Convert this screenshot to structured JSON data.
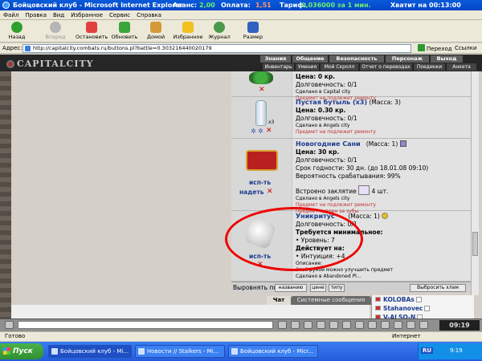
{
  "window": {
    "title": "Бойцовский клуб - Microsoft Internet Explorer",
    "advance_label": "Аванс:",
    "advance_value": "2,00",
    "payment_label": "Оплата:",
    "payment_value": "1,51",
    "tariff_label": "Тариф:",
    "tariff_value": "0,036000 за 1 мин.",
    "enough_text": "Хватит на 00:13:00"
  },
  "menu": [
    "Файл",
    "Правка",
    "Вид",
    "Избранное",
    "Сервис",
    "Справка"
  ],
  "toolbar": {
    "back": "Назад",
    "forward": "Вперед",
    "stop": "Остановить",
    "refresh": "Обновить",
    "home": "Домой",
    "favorites": "Избранное",
    "history": "Журнал",
    "size": "Размер"
  },
  "address": {
    "label": "Адрес:",
    "url": "http://capitalcity.combats.ru/buttons.pl?battle=0.303216440020179",
    "go": "Переход",
    "links": "Ссылки"
  },
  "game": {
    "logo": "CAPITALCITY",
    "nav_top": [
      "Знания",
      "Общение",
      "Безопасность",
      "Персонаж",
      "Выход"
    ],
    "nav_bottom": [
      "Инвентарь",
      "Умения",
      "Мой Скролл",
      "Отчет о переводах",
      "Поединки",
      "Анкета"
    ]
  },
  "items": [
    {
      "price": "Цена: 0 кр.",
      "durability": "Долговечность: 0/1",
      "made": "Сделано в Capital city",
      "repair": "Предмет не подлежит ремонту"
    },
    {
      "name": "Пустая бутыль (x3)",
      "mass": "(Масса: 3)",
      "price": "Цена: 0.30 кр.",
      "durability": "Долговечность: 0/1",
      "made": "Сделано в Angels city",
      "repair": "Предмет не подлежит ремонту",
      "count_badge": "x3"
    },
    {
      "name": "Новогодние Сани",
      "mass": "(Масса: 1)",
      "price": "Цена: 30 кр.",
      "durability": "Долговечность: 0/1",
      "expiry": "Срок годности: 30 дн. (до 18.01.08 09:10)",
      "chance": "Вероятность срабатывания: 99%",
      "spell": "Встроено заклятие",
      "spell_count": "4 шт.",
      "made": "Сделано в Angels city",
      "repair": "Предмет не подлежит ремонту",
      "bought": "Предмет куплен за зубы",
      "use": "исп-ть",
      "wear": "надеть"
    },
    {
      "name": "Уникритус",
      "mass": "(Масса: 1)",
      "durability": "Долговечность: 0/1",
      "req_title": "Требуется минимальное:",
      "req_level": "• Уровень: 7",
      "effect_title": "Действует на:",
      "effect_intuition": "• Интуиция: +4",
      "desc_title": "Описание:",
      "desc_text": "Этой руной можно улучшить предмет",
      "made": "Сделано в Abandoned Pl...",
      "use": "исп-ть"
    }
  ],
  "sort": {
    "label": "Выровнять по",
    "by_name": "названию",
    "by_price": "цене",
    "by_type": "типу",
    "drop_junk": "Выбросить хлам"
  },
  "chat": {
    "tab_chat": "Чат",
    "tab_system": "Системные сообщения"
  },
  "online": [
    "KOLOBAs",
    "Stahanovec",
    "V-ALSO-N"
  ],
  "clock": "09:19",
  "status": {
    "left": "Готово",
    "zone": "Интернет"
  },
  "taskbar": {
    "start": "Пуск",
    "tasks": [
      "Бойцовский клуб - Mi...",
      "Новости // Stalkers - Mi...",
      "Бойцовский клуб - Micr..."
    ],
    "lang": "RU",
    "time": "9:19"
  }
}
